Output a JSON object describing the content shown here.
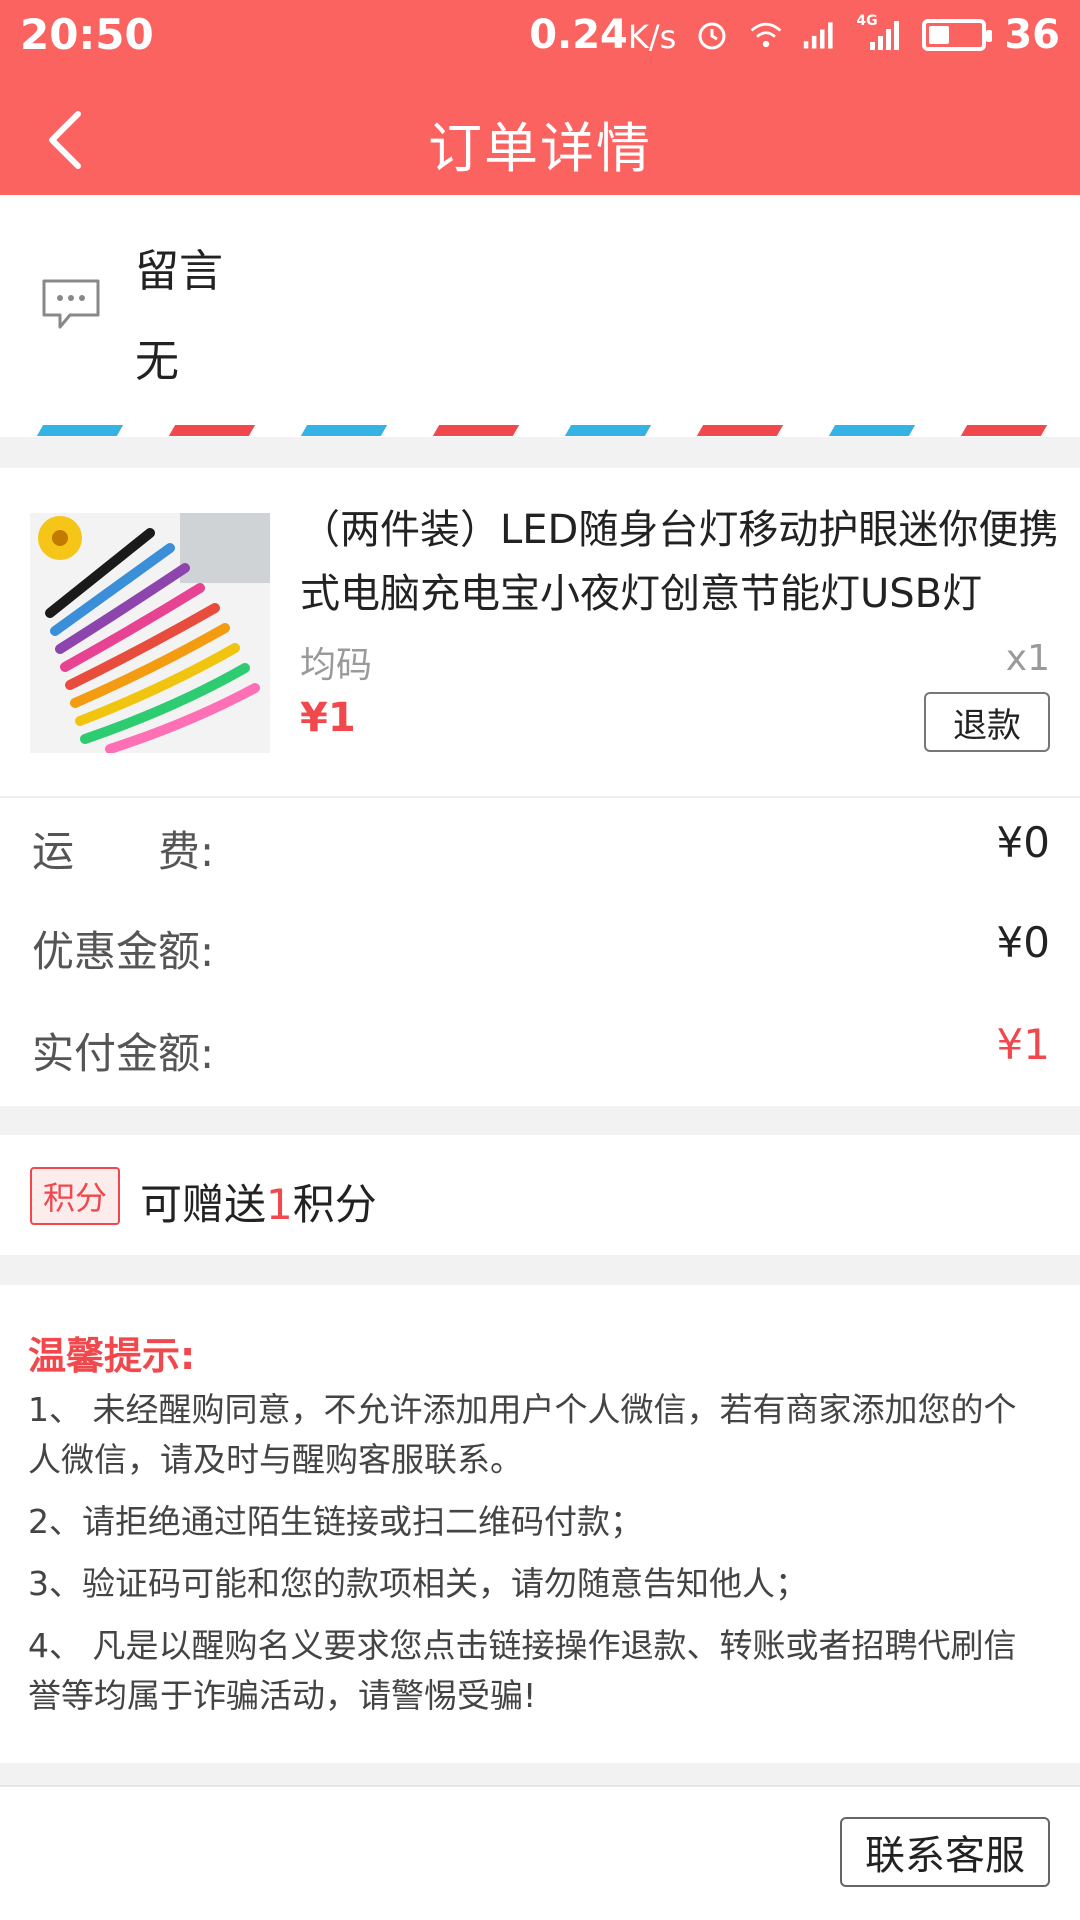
{
  "status_bar": {
    "time": "20:50",
    "speed": "0.24",
    "speed_unit": "K/s",
    "network": "4G",
    "battery": "36",
    "battery_level": 0.36
  },
  "header": {
    "title": "订单详情",
    "back_icon": "chevron-left-icon"
  },
  "message": {
    "label": "留言",
    "value": "无",
    "icon": "chat-bubble-icon"
  },
  "product": {
    "title": "（两件装）LED随身台灯移动护眼迷你便携式电脑充电宝小夜灯创意节能灯USB灯",
    "spec": "均码",
    "quantity": "x1",
    "price": "¥1",
    "refund_label": "退款"
  },
  "amounts": [
    {
      "label": "运　　费:",
      "value": "¥0"
    },
    {
      "label": "优惠金额:",
      "value": "¥0"
    },
    {
      "label": "实付金额:",
      "value": "¥1"
    }
  ],
  "points": {
    "badge": "积分",
    "prefix": "可赠送",
    "count": "1",
    "suffix": "积分"
  },
  "tips": {
    "title": "温馨提示:",
    "items": [
      "1、 未经醒购同意，不允许添加用户个人微信，若有商家添加您的个人微信，请及时与醒购客服联系。",
      "2、请拒绝通过陌生链接或扫二维码付款；",
      "3、验证码可能和您的款项相关，请勿随意告知他人；",
      "4、 凡是以醒购名义要求您点击链接操作退款、转账或者招聘代刷信誉等均属于诈骗活动，请警惕受骗!"
    ]
  },
  "footer": {
    "contact_label": "联系客服"
  },
  "colors": {
    "header": "#fb6361",
    "accent_red": "#f0484c",
    "stripe_blue": "#36b3e5"
  }
}
